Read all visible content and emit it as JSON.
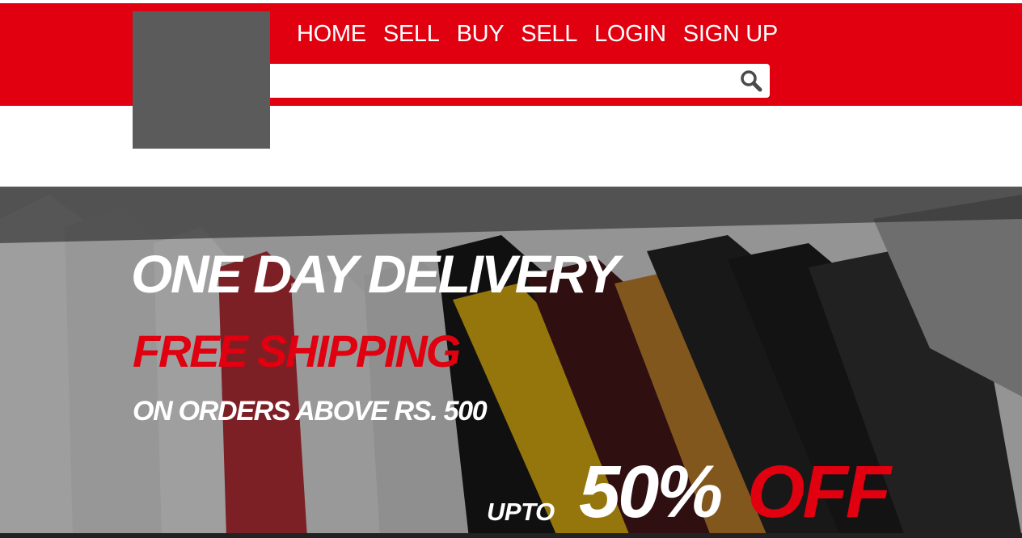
{
  "header": {
    "nav": [
      "HOME",
      "SELL",
      "BUY",
      "SELL",
      "LOGIN",
      "SIGN UP"
    ],
    "search": {
      "value": "",
      "placeholder": ""
    },
    "search_icon": "search-icon",
    "colors": {
      "brand_red": "#e0000f",
      "logo_gray": "#5b5b5b"
    }
  },
  "hero": {
    "line1": "ONE DAY DELIVERY",
    "line2": "FREE SHIPPING",
    "line3": "ON ORDERS ABOVE RS. 500",
    "upto": "UPTO",
    "percent": "50%",
    "off": "OFF"
  }
}
